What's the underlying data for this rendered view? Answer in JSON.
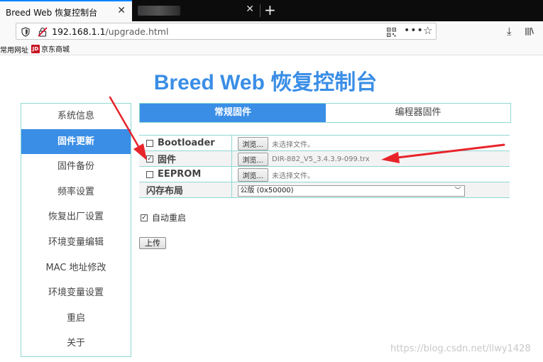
{
  "browser": {
    "active_tab_title": "Breed Web 恢复控制台",
    "url_host": "192.168.1.1",
    "url_path": "/upgrade.html",
    "bookmarks": [
      {
        "label": "常用网址"
      },
      {
        "label": "京东商城",
        "icon_text": "JD"
      }
    ]
  },
  "page": {
    "title": "Breed Web 恢复控制台",
    "sidebar": [
      {
        "label": "系统信息",
        "active": false
      },
      {
        "label": "固件更新",
        "active": true
      },
      {
        "label": "固件备份",
        "active": false
      },
      {
        "label": "频率设置",
        "active": false
      },
      {
        "label": "恢复出厂设置",
        "active": false
      },
      {
        "label": "环境变量编辑",
        "active": false
      },
      {
        "label": "MAC 地址修改",
        "active": false
      },
      {
        "label": "环境变量设置",
        "active": false
      },
      {
        "label": "重启",
        "active": false
      },
      {
        "label": "关于",
        "active": false
      }
    ],
    "tabs": [
      {
        "label": "常规固件",
        "active": true
      },
      {
        "label": "编程器固件",
        "active": false
      }
    ],
    "rows": [
      {
        "label": "Bootloader",
        "checked": false,
        "button": "浏览...",
        "file": "未选择文件。"
      },
      {
        "label": "固件",
        "checked": true,
        "button": "浏览...",
        "file": "DIR-882_V5_3.4.3.9-099.trx"
      },
      {
        "label": "EEPROM",
        "checked": false,
        "button": "浏览...",
        "file": "未选择文件。"
      }
    ],
    "flash_layout": {
      "label": "闪存布局",
      "selected": "公版 (0x50000)"
    },
    "auto_reboot": {
      "label": "自动重启",
      "checked": true
    },
    "upload_label": "上传"
  },
  "watermark": "https://blog.csdn.net/llwy1428",
  "colors": {
    "accent": "#3a8ee6",
    "border": "#8fd8d3",
    "arrow": "#e8242b"
  }
}
